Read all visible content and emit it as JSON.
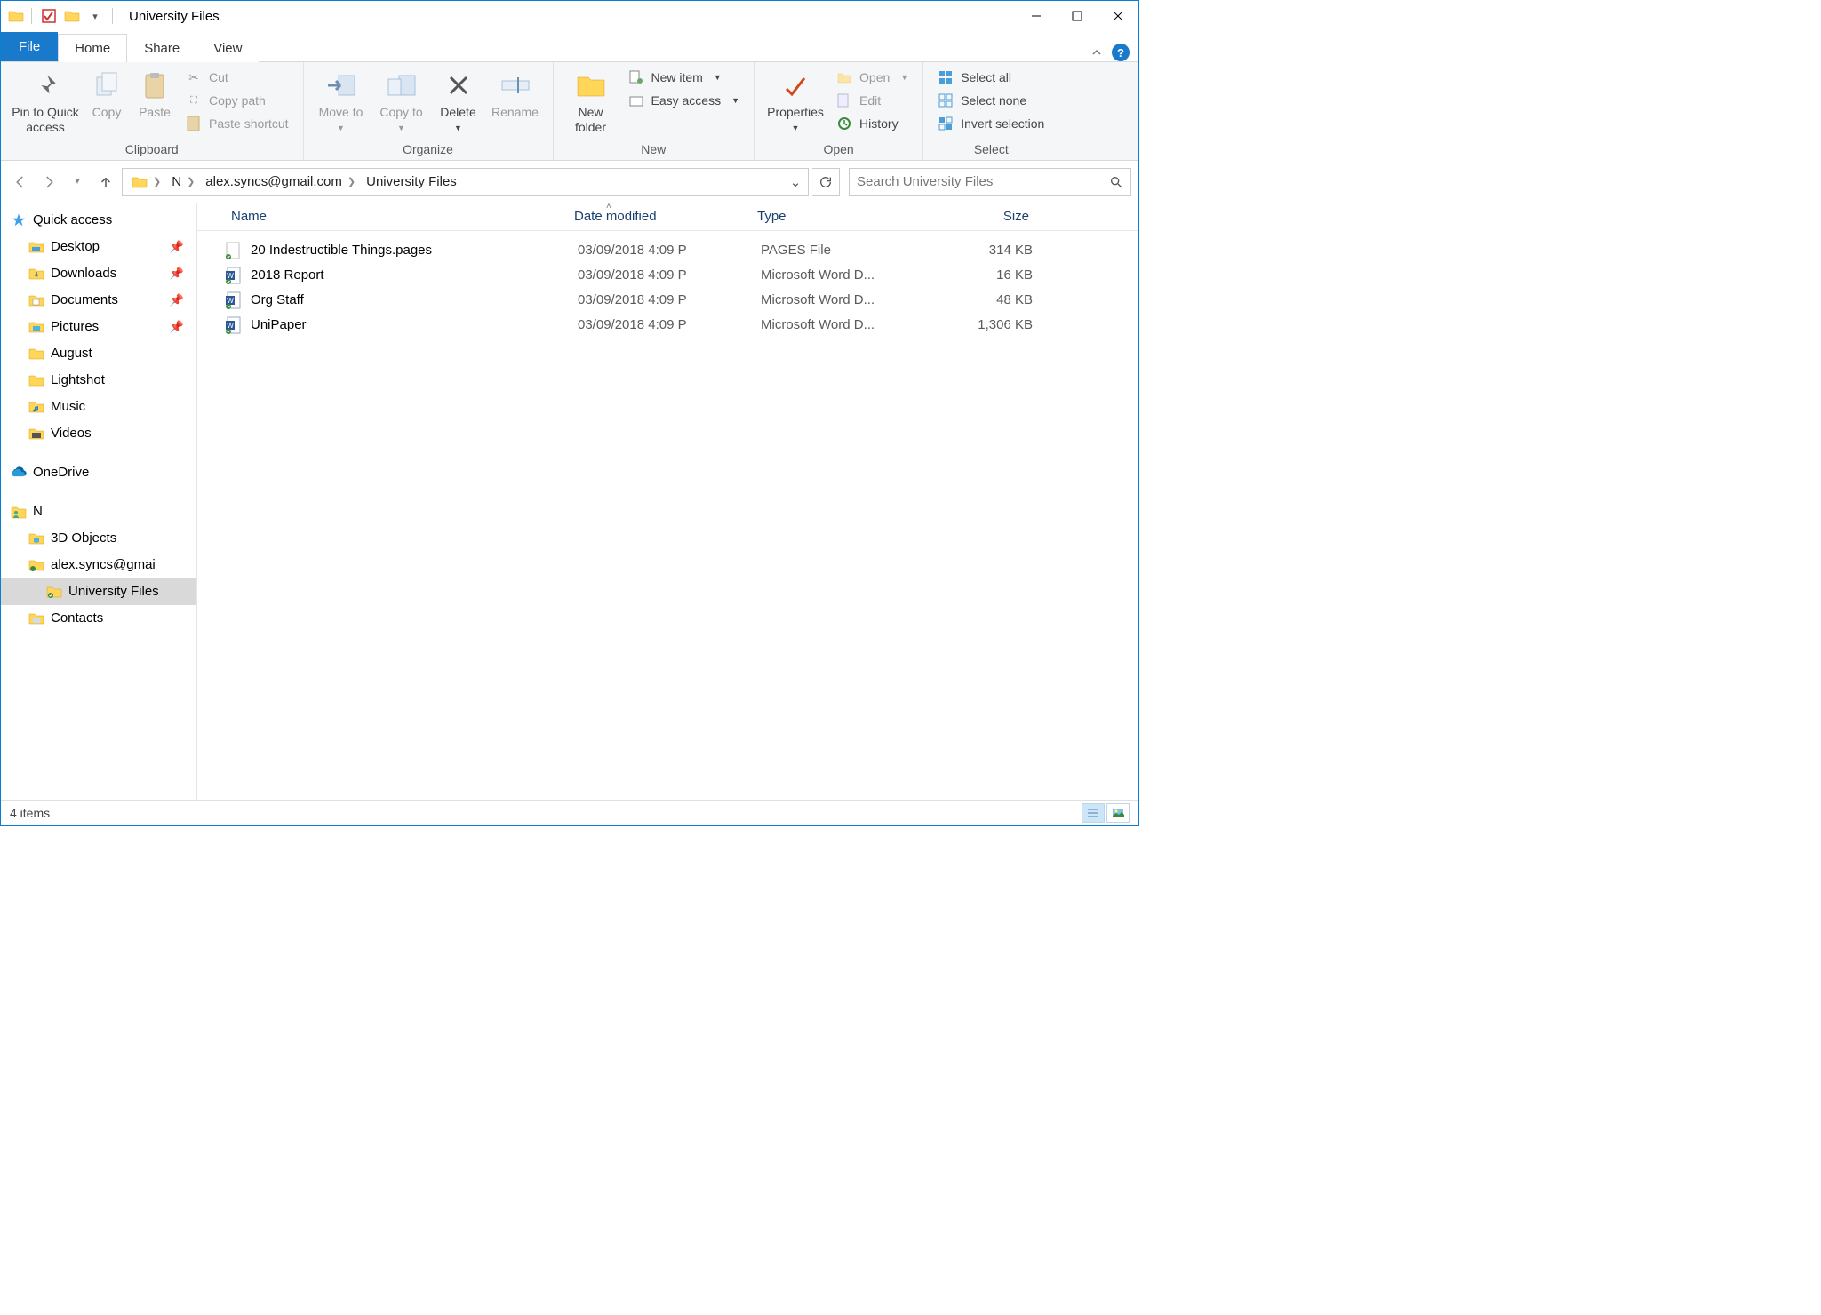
{
  "title": "University Files",
  "tabs": {
    "file": "File",
    "home": "Home",
    "share": "Share",
    "view": "View"
  },
  "ribbon": {
    "clipboard": {
      "label": "Clipboard",
      "pin": "Pin to Quick access",
      "copy": "Copy",
      "paste": "Paste",
      "cut": "Cut",
      "copypath": "Copy path",
      "pasteshortcut": "Paste shortcut"
    },
    "organize": {
      "label": "Organize",
      "moveto": "Move to",
      "copyto": "Copy to",
      "delete": "Delete",
      "rename": "Rename"
    },
    "new": {
      "label": "New",
      "newfolder": "New folder",
      "newitem": "New item",
      "easyaccess": "Easy access"
    },
    "open": {
      "label": "Open",
      "properties": "Properties",
      "open": "Open",
      "edit": "Edit",
      "history": "History"
    },
    "select": {
      "label": "Select",
      "all": "Select all",
      "none": "Select none",
      "invert": "Invert selection"
    }
  },
  "breadcrumb": {
    "root": "N",
    "mid": "alex.syncs@gmail.com",
    "leaf": "University Files"
  },
  "search_placeholder": "Search University Files",
  "sidebar": {
    "quick": "Quick access",
    "desktop": "Desktop",
    "downloads": "Downloads",
    "documents": "Documents",
    "pictures": "Pictures",
    "august": "August",
    "lightshot": "Lightshot",
    "music": "Music",
    "videos": "Videos",
    "onedrive": "OneDrive",
    "n": "N",
    "threed": "3D Objects",
    "alex": "alex.syncs@gmai",
    "uni": "University Files",
    "contacts": "Contacts"
  },
  "columns": {
    "name": "Name",
    "date": "Date modified",
    "type": "Type",
    "size": "Size"
  },
  "files": [
    {
      "icon": "pages",
      "name": "20 Indestructible Things.pages",
      "date": "03/09/2018 4:09 P",
      "type": "PAGES File",
      "size": "314 KB"
    },
    {
      "icon": "word",
      "name": "2018 Report",
      "date": "03/09/2018 4:09 P",
      "type": "Microsoft Word D...",
      "size": "16 KB"
    },
    {
      "icon": "word",
      "name": "Org Staff",
      "date": "03/09/2018 4:09 P",
      "type": "Microsoft Word D...",
      "size": "48 KB"
    },
    {
      "icon": "word",
      "name": "UniPaper",
      "date": "03/09/2018 4:09 P",
      "type": "Microsoft Word D...",
      "size": "1,306 KB"
    }
  ],
  "status": "4 items"
}
